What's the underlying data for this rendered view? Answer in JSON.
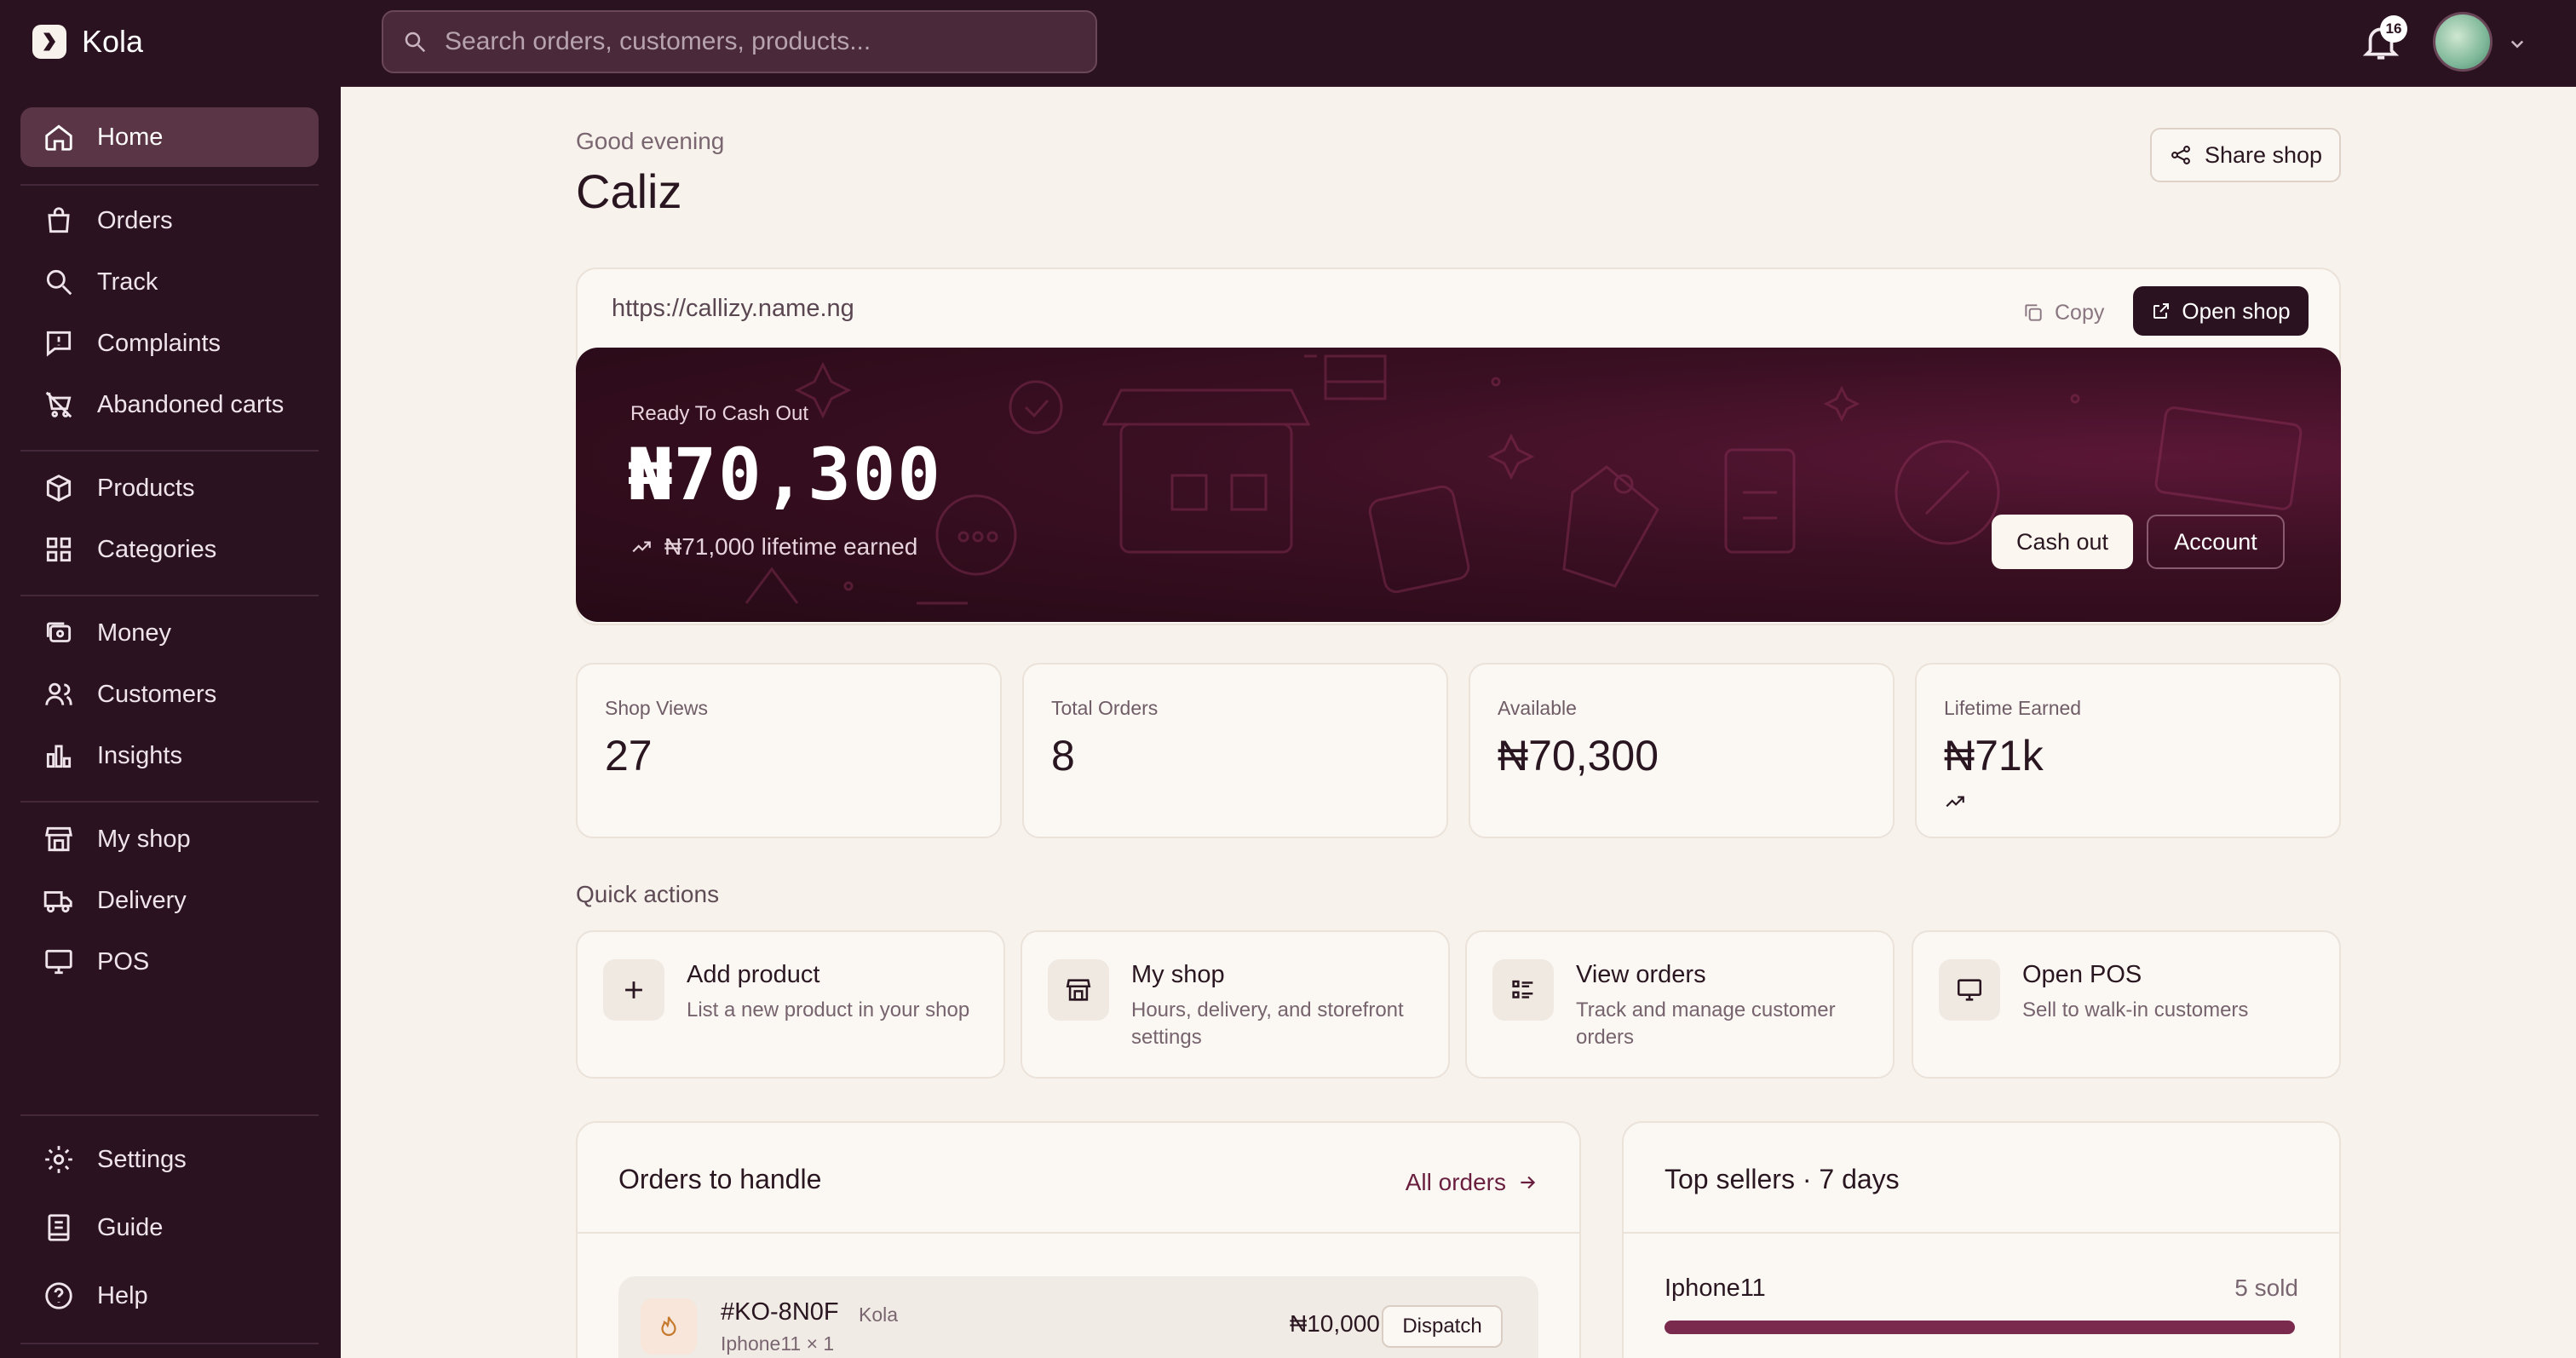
{
  "app": {
    "brand": "Kola"
  },
  "sidebar": {
    "items": [
      {
        "label": "Home",
        "icon": "home-icon",
        "active": true
      },
      {
        "label": "Orders",
        "icon": "shopping-bag-icon"
      },
      {
        "label": "Track",
        "icon": "search-icon"
      },
      {
        "label": "Complaints",
        "icon": "message-alert-icon"
      },
      {
        "label": "Abandoned carts",
        "icon": "cart-off-icon"
      },
      {
        "label": "Products",
        "icon": "box-icon"
      },
      {
        "label": "Categories",
        "icon": "grid-icon"
      },
      {
        "label": "Money",
        "icon": "wallet-icon"
      },
      {
        "label": "Customers",
        "icon": "users-icon"
      },
      {
        "label": "Insights",
        "icon": "bar-chart-icon"
      },
      {
        "label": "My shop",
        "icon": "store-icon"
      },
      {
        "label": "Delivery",
        "icon": "truck-icon"
      },
      {
        "label": "POS",
        "icon": "monitor-icon"
      },
      {
        "label": "Settings",
        "icon": "gear-icon"
      },
      {
        "label": "Guide",
        "icon": "book-icon"
      },
      {
        "label": "Help",
        "icon": "help-circle-icon"
      }
    ]
  },
  "topbar": {
    "search_placeholder": "Search orders, customers, products...",
    "notification_count": "16"
  },
  "main": {
    "greeting": "Good evening",
    "username": "Caliz",
    "share_label": "Share shop",
    "shop_url": "https://callizy.name.ng",
    "copy_label": "Copy",
    "open_shop_label": "Open shop",
    "cash": {
      "label": "Ready To Cash Out",
      "amount": "₦70,300",
      "lifetime": "₦71,000 lifetime earned",
      "cash_out_label": "Cash out",
      "account_label": "Account"
    },
    "stats": [
      {
        "label": "Shop Views",
        "value": "27"
      },
      {
        "label": "Total Orders",
        "value": "8"
      },
      {
        "label": "Available",
        "value": "₦70,300"
      },
      {
        "label": "Lifetime Earned",
        "value": "₦71k"
      }
    ],
    "quick_actions_title": "Quick actions",
    "quick_actions": [
      {
        "title": "Add product",
        "desc": "List a new product in your shop",
        "icon": "plus-icon"
      },
      {
        "title": "My shop",
        "desc": "Hours, delivery, and storefront settings",
        "icon": "store-icon"
      },
      {
        "title": "View orders",
        "desc": "Track and manage customer orders",
        "icon": "list-icon"
      },
      {
        "title": "Open POS",
        "desc": "Sell to walk-in customers",
        "icon": "monitor-icon"
      }
    ],
    "orders_panel": {
      "title": "Orders to handle",
      "all_orders_label": "All orders",
      "order": {
        "id": "#KO-8N0F",
        "store": "Kola",
        "item": "Iphone11 × 1",
        "price": "₦10,000",
        "action": "Dispatch"
      }
    },
    "top_sellers": {
      "title": "Top sellers · 7 days",
      "items": [
        {
          "name": "Iphone11",
          "sold": "5 sold",
          "fraction": 1.0
        }
      ]
    }
  },
  "colors": {
    "sidebar": "#2b1220",
    "accent": "#6a1e3e",
    "background": "#f7f2ec"
  }
}
